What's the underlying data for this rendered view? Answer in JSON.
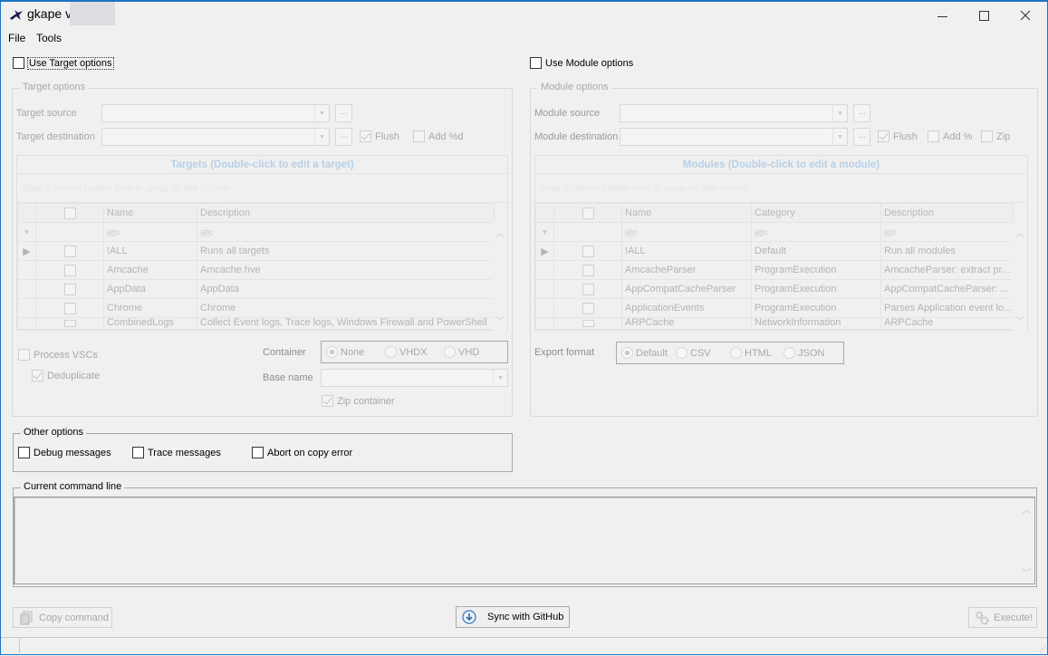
{
  "window": {
    "title": "gkape v",
    "controls": {
      "minimize": "—",
      "maximize": "☐",
      "close": "✕"
    }
  },
  "menu": {
    "items": [
      "File",
      "Tools"
    ]
  },
  "target": {
    "use_label": "Use Target options",
    "use_checked": false,
    "group_label": "Target options",
    "source_label": "Target source",
    "source_value": "",
    "destination_label": "Target destination",
    "destination_value": "",
    "browse_label": "...",
    "flush_label": "Flush",
    "flush_checked": true,
    "add_label": "Add %d",
    "add_checked": false,
    "grid": {
      "title": "Targets (Double-click to edit a target)",
      "group_hint": "Drag a column header here to group by that column",
      "filter_glyph": "a̲b̲c",
      "columns": [
        "Name",
        "Description"
      ],
      "rows": [
        {
          "name": "!ALL",
          "description": "Runs all targets"
        },
        {
          "name": "Amcache",
          "description": "Amcache.hve"
        },
        {
          "name": "AppData",
          "description": "AppData"
        },
        {
          "name": "Chrome",
          "description": "Chrome"
        },
        {
          "name": "CombinedLogs",
          "description": "Collect Event logs, Trace logs, Windows Firewall and PowerShell"
        }
      ]
    },
    "process_vscs_label": "Process VSCs",
    "process_vscs_checked": false,
    "deduplicate_label": "Deduplicate",
    "deduplicate_checked": true,
    "container_label": "Container",
    "container_options": [
      "None",
      "VHDX",
      "VHD"
    ],
    "container_selected": "None",
    "base_name_label": "Base name",
    "base_name_value": "",
    "zip_container_label": "Zip container",
    "zip_container_checked": true
  },
  "module": {
    "use_label": "Use Module options",
    "use_checked": false,
    "group_label": "Module options",
    "source_label": "Module source",
    "source_value": "",
    "destination_label": "Module destination",
    "destination_value": "",
    "browse_label": "...",
    "flush_label": "Flush",
    "flush_checked": true,
    "add_label": "Add %",
    "add_checked": false,
    "zip_label": "Zip",
    "zip_checked": false,
    "grid": {
      "title": "Modules (Double-click to edit a module)",
      "group_hint": "Drag a column header here to group by that column",
      "filter_glyph": "a̲b̲c",
      "columns": [
        "Name",
        "Category",
        "Description"
      ],
      "rows": [
        {
          "name": "!ALL",
          "category": "Default",
          "description": "Run all modules"
        },
        {
          "name": "AmcacheParser",
          "category": "ProgramExecution",
          "description": "AmcacheParser: extract pr..."
        },
        {
          "name": "AppCompatCacheParser",
          "category": "ProgramExecution",
          "description": "AppCompatCacheParser: ..."
        },
        {
          "name": "ApplicationEvents",
          "category": "ProgramExecution",
          "description": "Parses Application event lo..."
        },
        {
          "name": "ARPCache",
          "category": "NetworkInformation",
          "description": "ARPCache"
        }
      ]
    },
    "export_label": "Export format",
    "export_options": [
      "Default",
      "CSV",
      "HTML",
      "JSON"
    ],
    "export_selected": "Default"
  },
  "other": {
    "group_label": "Other options",
    "debug_label": "Debug messages",
    "trace_label": "Trace messages",
    "abort_label": "Abort on copy error"
  },
  "command": {
    "group_label": "Current command line",
    "value": ""
  },
  "buttons": {
    "copy": "Copy command",
    "sync": "Sync with GitHub",
    "execute": "Execute!"
  }
}
